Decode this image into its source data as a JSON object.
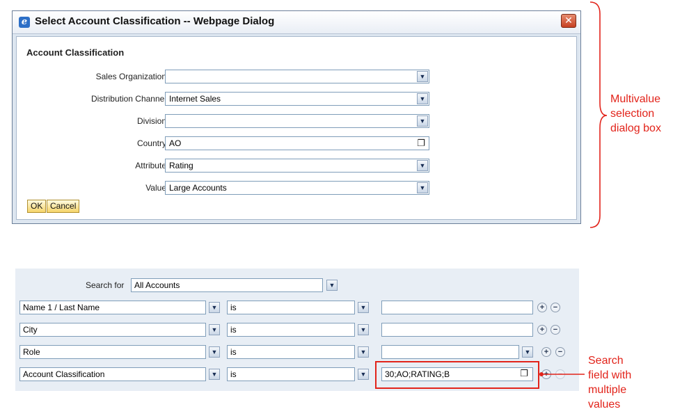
{
  "dialog": {
    "title": "Select Account Classification -- Webpage Dialog",
    "close_icon": "✕",
    "section_title": "Account Classification",
    "fields": [
      {
        "label": "Sales Organization",
        "value": "",
        "control": "dropdown"
      },
      {
        "label": "Distribution Channel",
        "value": "Internet Sales",
        "control": "dropdown"
      },
      {
        "label": "Division",
        "value": "",
        "control": "dropdown"
      },
      {
        "label": "Country",
        "value": "AO",
        "control": "value-help"
      },
      {
        "label": "Attribute",
        "value": "Rating",
        "control": "dropdown"
      },
      {
        "label": "Value",
        "value": "Large Accounts",
        "control": "dropdown"
      }
    ],
    "ok_label": "OK",
    "cancel_label": "Cancel"
  },
  "annotations": {
    "dialog_note": [
      "Multivalue",
      "selection",
      "dialog box"
    ],
    "search_note": [
      "Search",
      "field with",
      "multiple",
      "values"
    ],
    "color": "#e2231a"
  },
  "search": {
    "search_for_label": "Search for",
    "search_for_value": "All Accounts",
    "rows": [
      {
        "field": "Name 1 / Last Name",
        "operator": "is",
        "value": ""
      },
      {
        "field": "City",
        "operator": "is",
        "value": ""
      },
      {
        "field": "Role",
        "operator": "is",
        "value": ""
      },
      {
        "field": "Account Classification",
        "operator": "is",
        "value": "30;AO;RATING;B"
      }
    ],
    "plus_symbol": "+",
    "minus_symbol": "−"
  }
}
